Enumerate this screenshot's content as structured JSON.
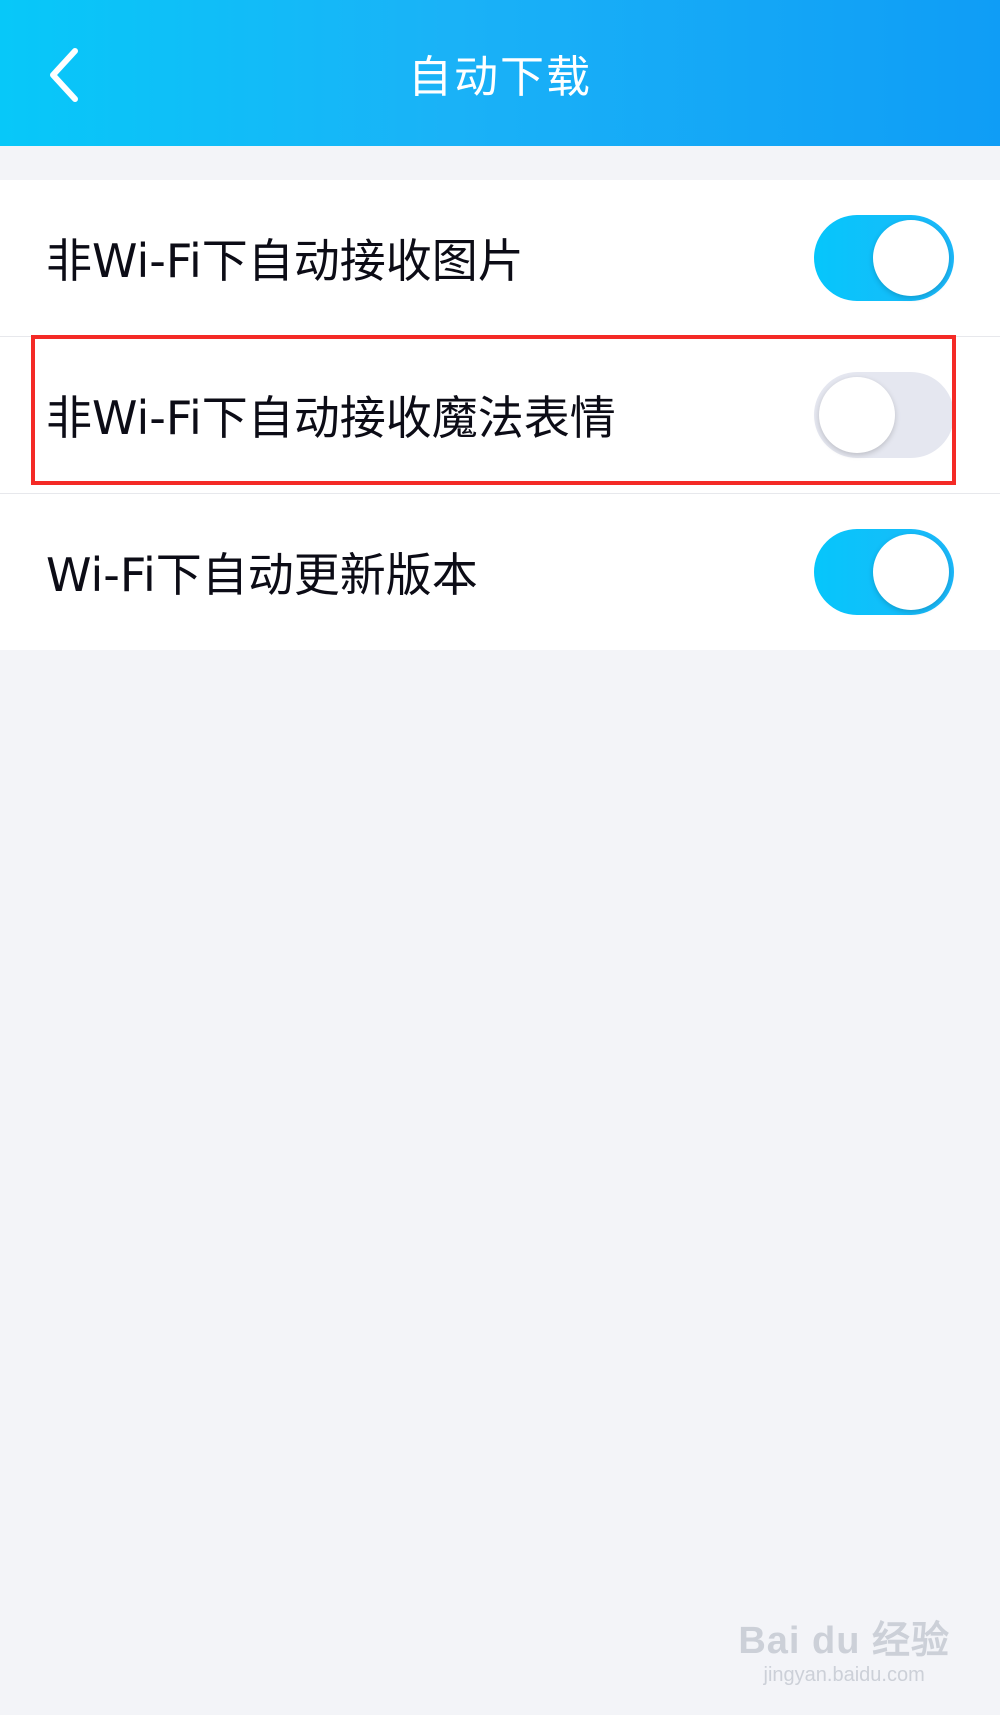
{
  "header": {
    "title": "自动下载",
    "back_icon": "chevron-left-icon"
  },
  "settings": [
    {
      "label": "非Wi-Fi下自动接收图片",
      "enabled": true
    },
    {
      "label": "非Wi-Fi下自动接收魔法表情",
      "enabled": false,
      "highlighted": true
    },
    {
      "label": "Wi-Fi下自动更新版本",
      "enabled": true
    }
  ],
  "watermark": {
    "logo": "Bai du 经验",
    "url": "jingyan.baidu.com"
  },
  "colors": {
    "header_gradient_start": "#07c8f9",
    "header_gradient_end": "#0f9df6",
    "toggle_on": "#0cc1fb",
    "toggle_off": "#e5e7f0",
    "highlight": "#f42a26",
    "background": "#f3f4f8"
  }
}
